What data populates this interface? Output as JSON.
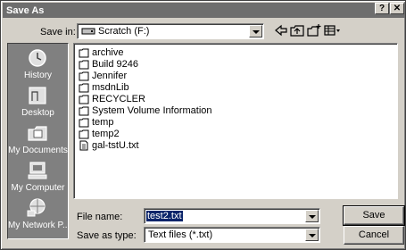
{
  "window": {
    "title": "Save As",
    "help_button": "?",
    "close_button": "✕"
  },
  "toolbar": {
    "save_in_label": "Save in:",
    "save_in_value": "Scratch (F:)",
    "icons": [
      "back-icon",
      "up-folder-icon",
      "new-folder-icon",
      "views-menu-icon"
    ]
  },
  "places": [
    {
      "label": "History",
      "icon": "history-icon"
    },
    {
      "label": "Desktop",
      "icon": "desktop-icon"
    },
    {
      "label": "My Documents",
      "icon": "my-documents-icon"
    },
    {
      "label": "My Computer",
      "icon": "my-computer-icon"
    },
    {
      "label": "My Network P...",
      "icon": "network-places-icon"
    }
  ],
  "files": [
    {
      "name": "archive",
      "type": "folder"
    },
    {
      "name": "Build 9246",
      "type": "folder"
    },
    {
      "name": "Jennifer",
      "type": "folder"
    },
    {
      "name": "msdnLib",
      "type": "folder"
    },
    {
      "name": "RECYCLER",
      "type": "folder"
    },
    {
      "name": "System Volume Information",
      "type": "folder"
    },
    {
      "name": "temp",
      "type": "folder"
    },
    {
      "name": "temp2",
      "type": "folder"
    },
    {
      "name": "gal-tstU.txt",
      "type": "text-file"
    }
  ],
  "footer": {
    "file_name_label": "File name:",
    "file_name_value": "test2.txt",
    "save_as_type_label": "Save as type:",
    "save_as_type_value": "Text files (*.txt)",
    "save_button": "Save",
    "cancel_button": "Cancel"
  }
}
